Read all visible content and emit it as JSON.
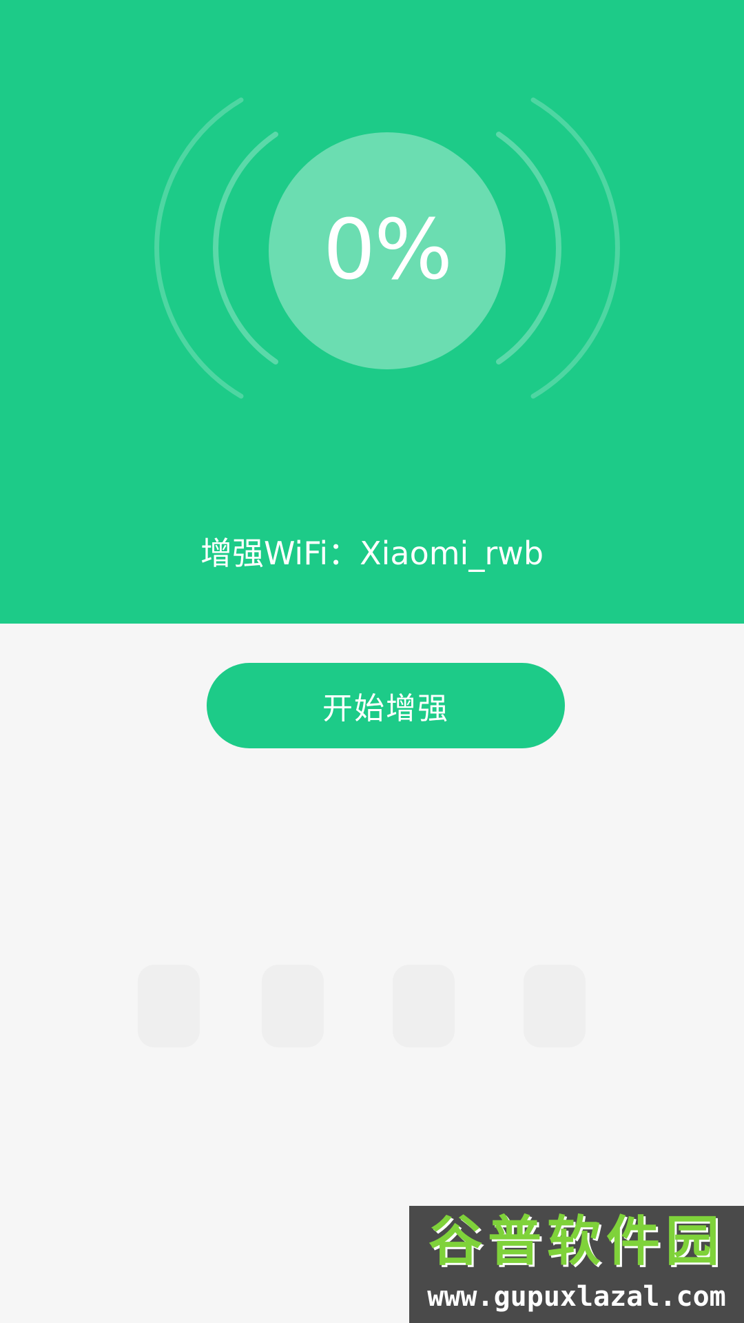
{
  "hero": {
    "progress": "0%",
    "wifi_text": "增强WiFi：Xiaomi_rwb",
    "background_color": "#1dcb88"
  },
  "actions": {
    "start_label": "开始增强"
  },
  "watermark": {
    "title": "谷普软件园",
    "url": "www.gupuxlazal.com"
  }
}
